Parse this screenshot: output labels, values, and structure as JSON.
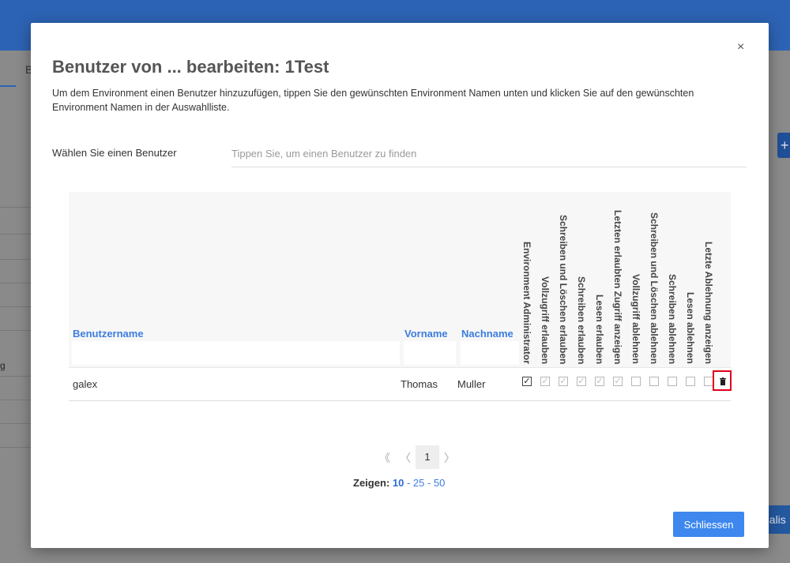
{
  "background": {
    "tab_fragment": "B",
    "side_letter": "g",
    "button_fragment": "ualis",
    "button_plus": "+"
  },
  "modal": {
    "close_glyph": "×",
    "title": "Benutzer von ... bearbeiten: 1Test",
    "description": "Um dem Environment einen Benutzer hinzuzufügen, tippen Sie den gewünschten Environment Namen unten und klicken Sie auf den gewünschten Environment Namen in der Auswahlliste.",
    "user_select_label": "Wählen Sie einen Benutzer",
    "user_select_placeholder": "Tippen Sie, um einen Benutzer zu finden",
    "table": {
      "columns": {
        "username": "Benutzername",
        "first_name": "Vorname",
        "last_name": "Nachname"
      },
      "permission_headers": [
        "Environment Administrator",
        "Vollzugriff erlauben",
        "Schreiben und Löschen erlauben",
        "Schreiben erlauben",
        "Lesen erlauben",
        "Letzten erlaubten Zugriff anzeigen",
        "Vollzugriff ablehnen",
        "Schreiben und Löschen ablehnen",
        "Schreiben ablehnen",
        "Lesen ablehnen",
        "Letzte Ablehnung anzeigen"
      ],
      "rows": [
        {
          "username": "galex",
          "first_name": "Thomas",
          "last_name": "Muller",
          "permissions": [
            true,
            true,
            true,
            true,
            true,
            true,
            false,
            false,
            false,
            false,
            false
          ]
        }
      ],
      "delete_icon": "trash-icon"
    },
    "pagination": {
      "first": "《",
      "prev": "〈",
      "current": "1",
      "next": "〉"
    },
    "page_size": {
      "label": "Zeigen:",
      "selected": "10",
      "options": [
        "25",
        "50"
      ],
      "separator": " - "
    },
    "close_button": "Schliessen"
  },
  "colors": {
    "accent": "#3d87ee",
    "link": "#3c7de0",
    "highlight": "#e0001b"
  }
}
